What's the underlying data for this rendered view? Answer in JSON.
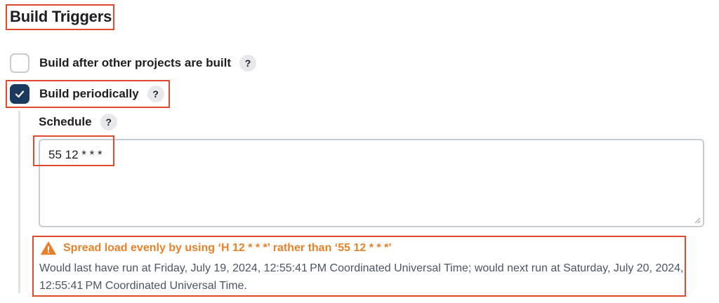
{
  "section": {
    "title": "Build Triggers"
  },
  "triggers": [
    {
      "label": "Build after other projects are built",
      "checked": false,
      "help": "?"
    },
    {
      "label": "Build periodically",
      "checked": true,
      "help": "?"
    }
  ],
  "schedule": {
    "label": "Schedule",
    "help": "?",
    "value": "55 12 * * *"
  },
  "validation": {
    "warning": "Spread load evenly by using ‘H 12 * * *’ rather than ‘55 12 * * *’",
    "info": "Would last have run at Friday, July 19, 2024, 12:55:41 PM Coordinated Universal Time; would next run at Saturday, July 20, 2024, 12:55:41 PM Coordinated Universal Time.",
    "warning_color": "#e8822a"
  },
  "colors": {
    "highlight": "#e04a2f",
    "checkbox_checked": "#1c3a5e"
  }
}
